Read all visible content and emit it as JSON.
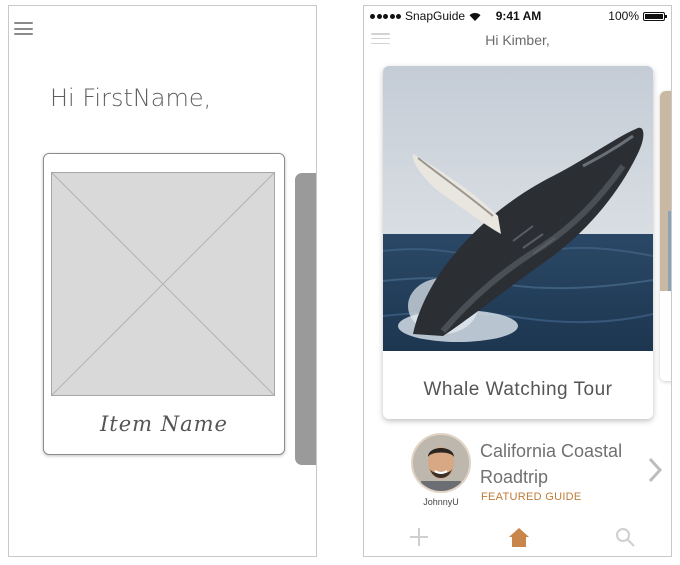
{
  "wireframe": {
    "greeting": "Hi FirstName,",
    "card": {
      "item_name": "Item Name"
    },
    "icons": {
      "menu": "hamburger-menu-icon",
      "placeholder": "image-placeholder-icon"
    }
  },
  "app": {
    "status_bar": {
      "carrier": "SnapGuide",
      "time": "9:41 AM",
      "battery": "100%"
    },
    "greeting": "Hi Kimber,",
    "featured_card": {
      "title": "Whale Watching Tour"
    },
    "featured_guide": {
      "title": "California Coastal Roadtrip",
      "badge": "FEATURED GUIDE",
      "username": "JohnnyU"
    },
    "tabbar": {
      "items": [
        {
          "icon": "plus-icon",
          "active": false
        },
        {
          "icon": "home-icon",
          "active": true
        },
        {
          "icon": "search-icon",
          "active": false
        }
      ]
    },
    "colors": {
      "accent": "#c9864a",
      "badge": "#c07a36",
      "inactive_icon": "#cfcfcf"
    }
  }
}
